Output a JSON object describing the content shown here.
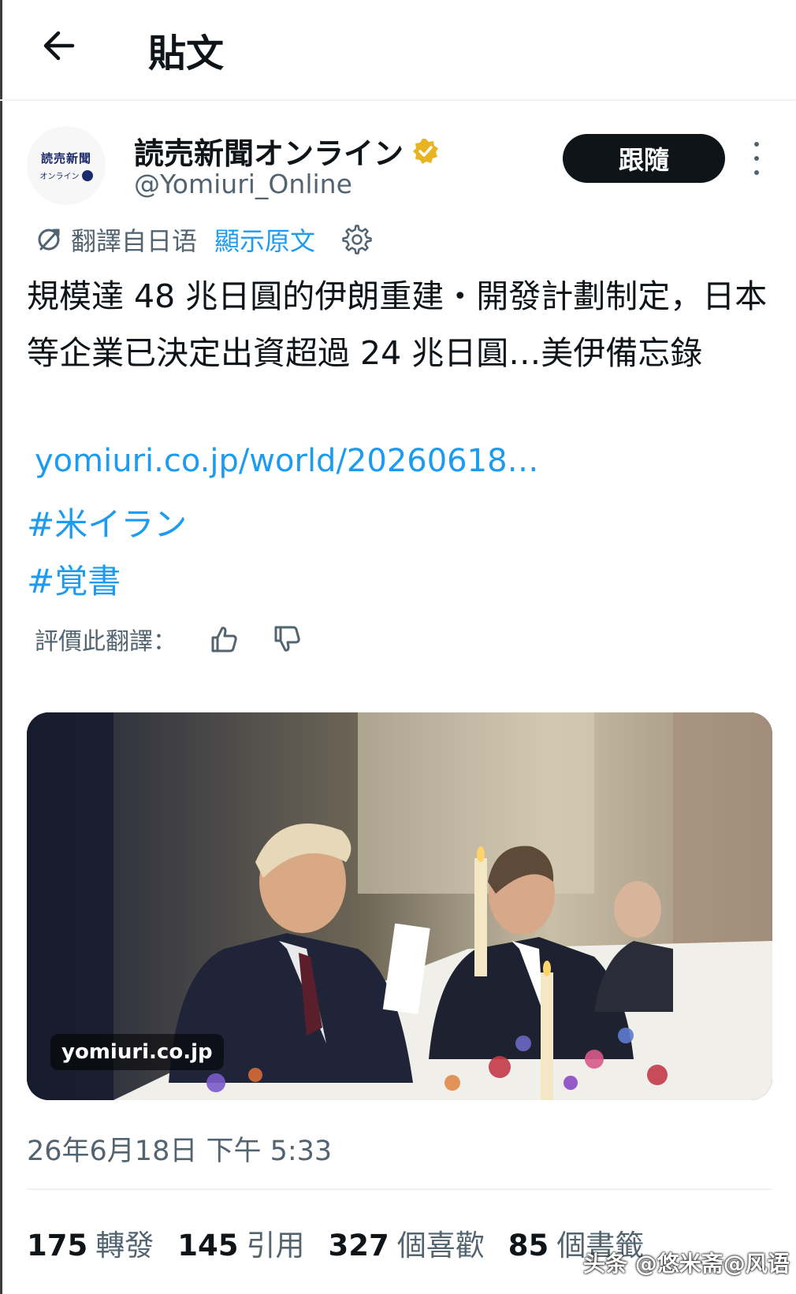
{
  "header": {
    "title": "貼文"
  },
  "author": {
    "name": "読売新聞オンライン",
    "handle": "@Yomiuri_Online",
    "avatar_text_top": "読売新聞",
    "avatar_text_bottom": "オンライン",
    "verified_color": "#e8b422"
  },
  "follow": {
    "label": "跟隨"
  },
  "translation": {
    "label": "翻譯自日语",
    "show_original": "顯示原文"
  },
  "tweet": {
    "text": "規模達 48 兆日圓的伊朗重建・開發計劃制定，日本等企業已決定出資超過 24 兆日圓…美伊備忘錄",
    "link": "yomiuri.co.jp/world/20260618…",
    "hashtags": [
      "#米イラン",
      "#覚書"
    ]
  },
  "rate": {
    "label": "評價此翻譯："
  },
  "media": {
    "caption": "yomiuri.co.jp"
  },
  "timestamp": "26年6月18日 下午 5:33",
  "stats": [
    {
      "value": "175",
      "label": "轉發"
    },
    {
      "value": "145",
      "label": "引用"
    },
    {
      "value": "327",
      "label": "個喜歡"
    },
    {
      "value": "85",
      "label": "個書籤"
    }
  ],
  "watermark": "头条 @悠米斋@风语",
  "colors": {
    "link": "#1d9bf0",
    "secondary_text": "#536471",
    "primary_text": "#0f1419"
  }
}
